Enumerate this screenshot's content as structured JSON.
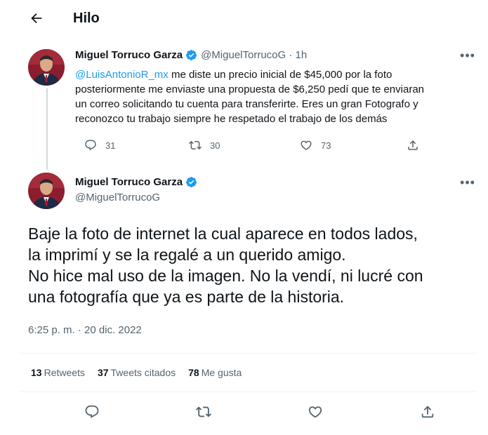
{
  "header": {
    "title": "Hilo"
  },
  "tweet1": {
    "name": "Miguel Torruco Garza",
    "handle_time": "@MiguelTorrucoG · 1h",
    "mention": "@LuisAntonioR_mx",
    "lines": [
      " me diste un precio inicial de $45,000 por la foto",
      "posteriormente me enviaste una propuesta de $6,250 pedí que te enviaran",
      "un correo solicitando tu cuenta para transferirte. Eres un gran Fotografo y",
      "reconozco tu trabajo siempre he respetado el trabajo de los demás"
    ],
    "replies": "31",
    "retweets": "30",
    "likes": "73"
  },
  "tweet2": {
    "name": "Miguel Torruco Garza",
    "handle": "@MiguelTorrucoG",
    "lines": [
      "Baje la foto de internet la cual aparece en todos lados,",
      "la imprimí y se la regalé a un querido amigo.",
      "No hice mal uso de la imagen. No la vendí, ni lucré con",
      "una fotografía que ya es parte de la historia."
    ],
    "timestamp": "6:25 p. m. · 20 dic. 2022",
    "stats": {
      "retweets_count": "13",
      "retweets_label": "Retweets",
      "quotes_count": "37",
      "quotes_label": "Tweets citados",
      "likes_count": "78",
      "likes_label": "Me gusta"
    }
  },
  "icons": {
    "back": "arrow-left-icon",
    "verified": "verified-badge-icon",
    "more": "more-icon",
    "reply": "reply-icon",
    "retweet": "retweet-icon",
    "like": "heart-icon",
    "share": "share-icon"
  },
  "colors": {
    "accent": "#1d9bf0",
    "muted": "#536471",
    "text": "#0f1419",
    "divider": "#eff3f4"
  }
}
